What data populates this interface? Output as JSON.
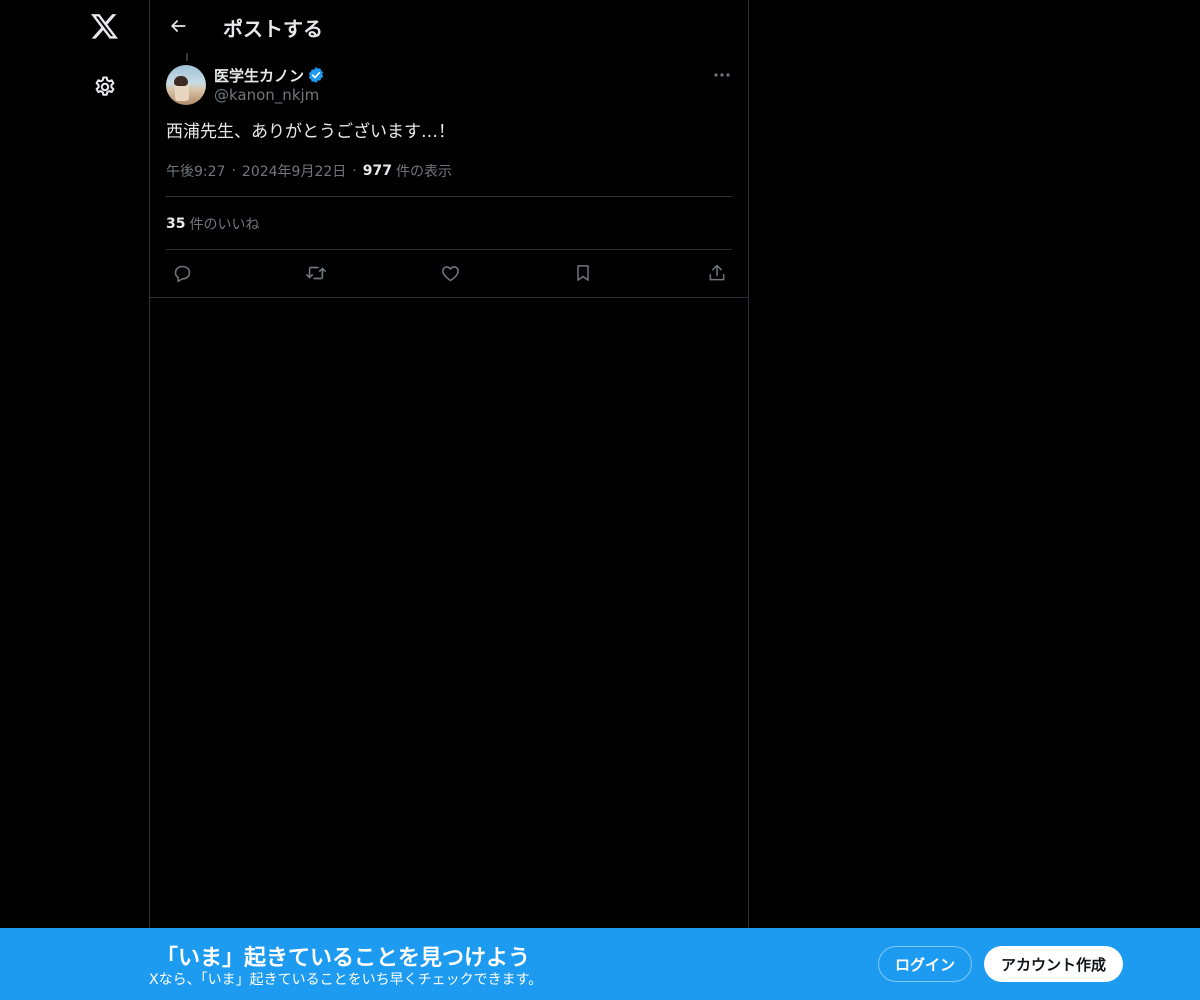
{
  "nav": {
    "logo_icon": "x-logo-icon",
    "settings_icon": "gear-icon"
  },
  "header": {
    "back_icon": "arrow-left-icon",
    "title": "ポストする"
  },
  "post": {
    "author_name": "医学生カノン",
    "verified_icon": "verified-badge-icon",
    "verified_color": "#1d9bf0",
    "handle": "@kanon_nkjm",
    "text": "西浦先生、ありがとうございます…！",
    "time": "午後9:27",
    "date": "2024年9月22日",
    "views_count": "977",
    "views_label": "件の表示",
    "likes_count": "35",
    "likes_label": "件のいいね",
    "more_icon": "more-horizontal-icon"
  },
  "actions": [
    {
      "name": "reply",
      "icon": "reply-icon"
    },
    {
      "name": "repost",
      "icon": "repost-icon"
    },
    {
      "name": "like",
      "icon": "heart-icon"
    },
    {
      "name": "bookmark",
      "icon": "bookmark-icon"
    },
    {
      "name": "share",
      "icon": "share-icon"
    }
  ],
  "banner": {
    "title": "「いま」起きていることを見つけよう",
    "subtitle": "Xなら、「いま」起きていることをいち早くチェックできます。",
    "login_label": "ログイン",
    "signup_label": "アカウント作成",
    "background_color": "#1d9bf0"
  }
}
